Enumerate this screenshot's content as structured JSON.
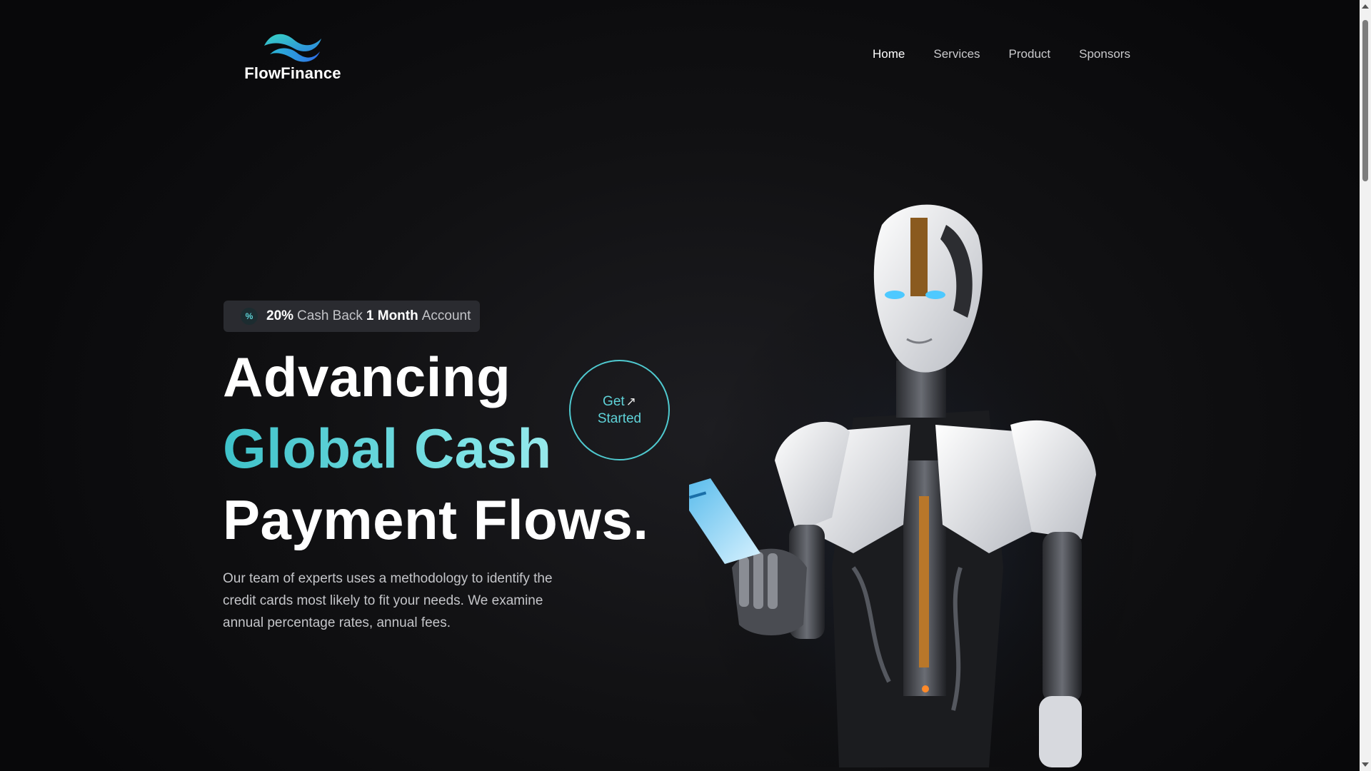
{
  "brand": {
    "name": "FlowFinance",
    "logo_icon": "wave-logo-icon",
    "accent": "#4fc9cf"
  },
  "nav": {
    "items": [
      "Home",
      "Services",
      "Product",
      "Sponsors"
    ],
    "active": "Home"
  },
  "badge": {
    "icon": "percent-icon",
    "part1": "20%",
    "part2": "Cash Back",
    "part3": "1 Month",
    "part4": "Account"
  },
  "hero": {
    "line1": "Advancing",
    "line2": "Global Cash",
    "line3": "Payment Flows.",
    "description": "Our team of experts uses a methodology to identify the credit cards most likely to fit your needs. We examine annual percentage rates, annual fees."
  },
  "cta": {
    "line1": "Get",
    "arrow": "↗",
    "line2": "Started"
  }
}
